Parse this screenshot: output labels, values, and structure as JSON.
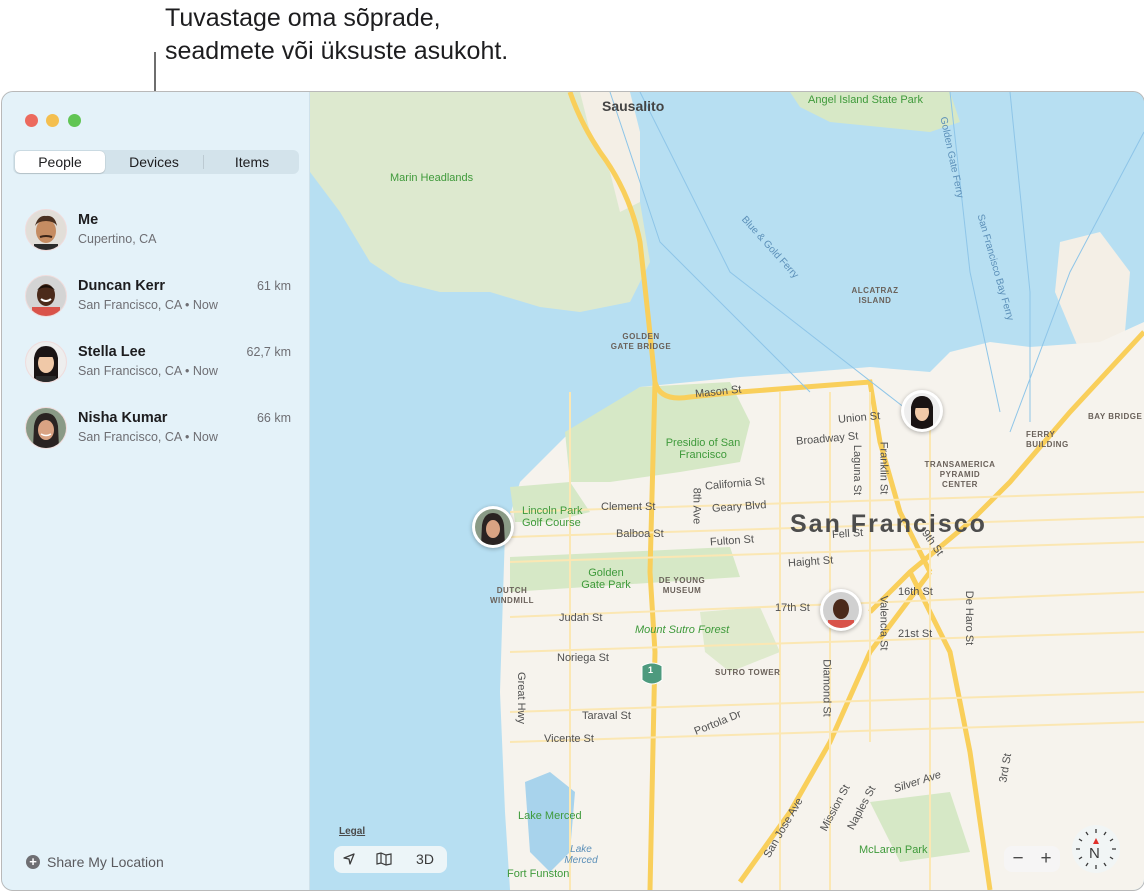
{
  "callout": {
    "line1": "Tuvastage oma sõprade,",
    "line2": "seadmete või üksuste asukoht."
  },
  "window": {
    "traffic_lights": [
      "close",
      "minimize",
      "zoom"
    ],
    "colors": {
      "close": "#ec6a5e",
      "minimize": "#f4bf4f",
      "zoom": "#61c554"
    }
  },
  "tabs": [
    {
      "label": "People",
      "selected": true
    },
    {
      "label": "Devices",
      "selected": false
    },
    {
      "label": "Items",
      "selected": false
    }
  ],
  "people": [
    {
      "name": "Me",
      "detail": "Cupertino, CA",
      "distance": ""
    },
    {
      "name": "Duncan Kerr",
      "detail": "San Francisco, CA • Now",
      "distance": "61 km"
    },
    {
      "name": "Stella Lee",
      "detail": "San Francisco, CA • Now",
      "distance": "62,7 km"
    },
    {
      "name": "Nisha Kumar",
      "detail": "San Francisco, CA • Now",
      "distance": "66 km"
    }
  ],
  "share_location": {
    "label": "Share My Location",
    "icon": "plus-circle-icon"
  },
  "map": {
    "city_label": "San Francisco",
    "town_labels": [
      "Sausalito"
    ],
    "parks": [
      "Marin Headlands",
      "Angel Island State Park",
      "Presidio of San Francisco",
      "Lincoln Park Golf Course",
      "Golden Gate Park",
      "Mount Sutro Forest",
      "Lake Merced",
      "Fort Funston",
      "McLaren Park"
    ],
    "landmarks": [
      "GOLDEN GATE BRIDGE",
      "ALCATRAZ ISLAND",
      "TRANSAMERICA PYRAMID CENTER",
      "FERRY BUILDING",
      "BAY BRIDGE",
      "DUTCH WINDMILL",
      "DE YOUNG MUSEUM",
      "SUTRO TOWER"
    ],
    "water_labels": [
      "Blue & Gold Ferry",
      "Golden Gate Ferry",
      "San Francisco Bay Ferry",
      "Lake Merced"
    ],
    "streets": [
      "Mason St",
      "Union St",
      "Broadway St",
      "Laguna St",
      "Franklin St",
      "California St",
      "Clement St",
      "Geary Blvd",
      "8th Ave",
      "Balboa St",
      "Fulton St",
      "Fell St",
      "Haight St",
      "9th St",
      "16th St",
      "17th St",
      "Valencia St",
      "21st St",
      "De Haro St",
      "Judah St",
      "Noriega St",
      "Taraval St",
      "Vicente St",
      "Great Hwy",
      "Portola Dr",
      "Diamond St",
      "Silver Ave",
      "San Jose Ave",
      "Mission St",
      "Naples St",
      "3rd St"
    ],
    "highway_shield": "1",
    "legal_label": "Legal",
    "controls": {
      "location": "location-arrow-icon",
      "map_mode": "map-icon",
      "three_d": "3D"
    },
    "zoom": {
      "out": "−",
      "in": "+"
    },
    "compass": "N",
    "pins": [
      "Stella Lee",
      "Nisha Kumar",
      "Duncan Kerr"
    ]
  }
}
